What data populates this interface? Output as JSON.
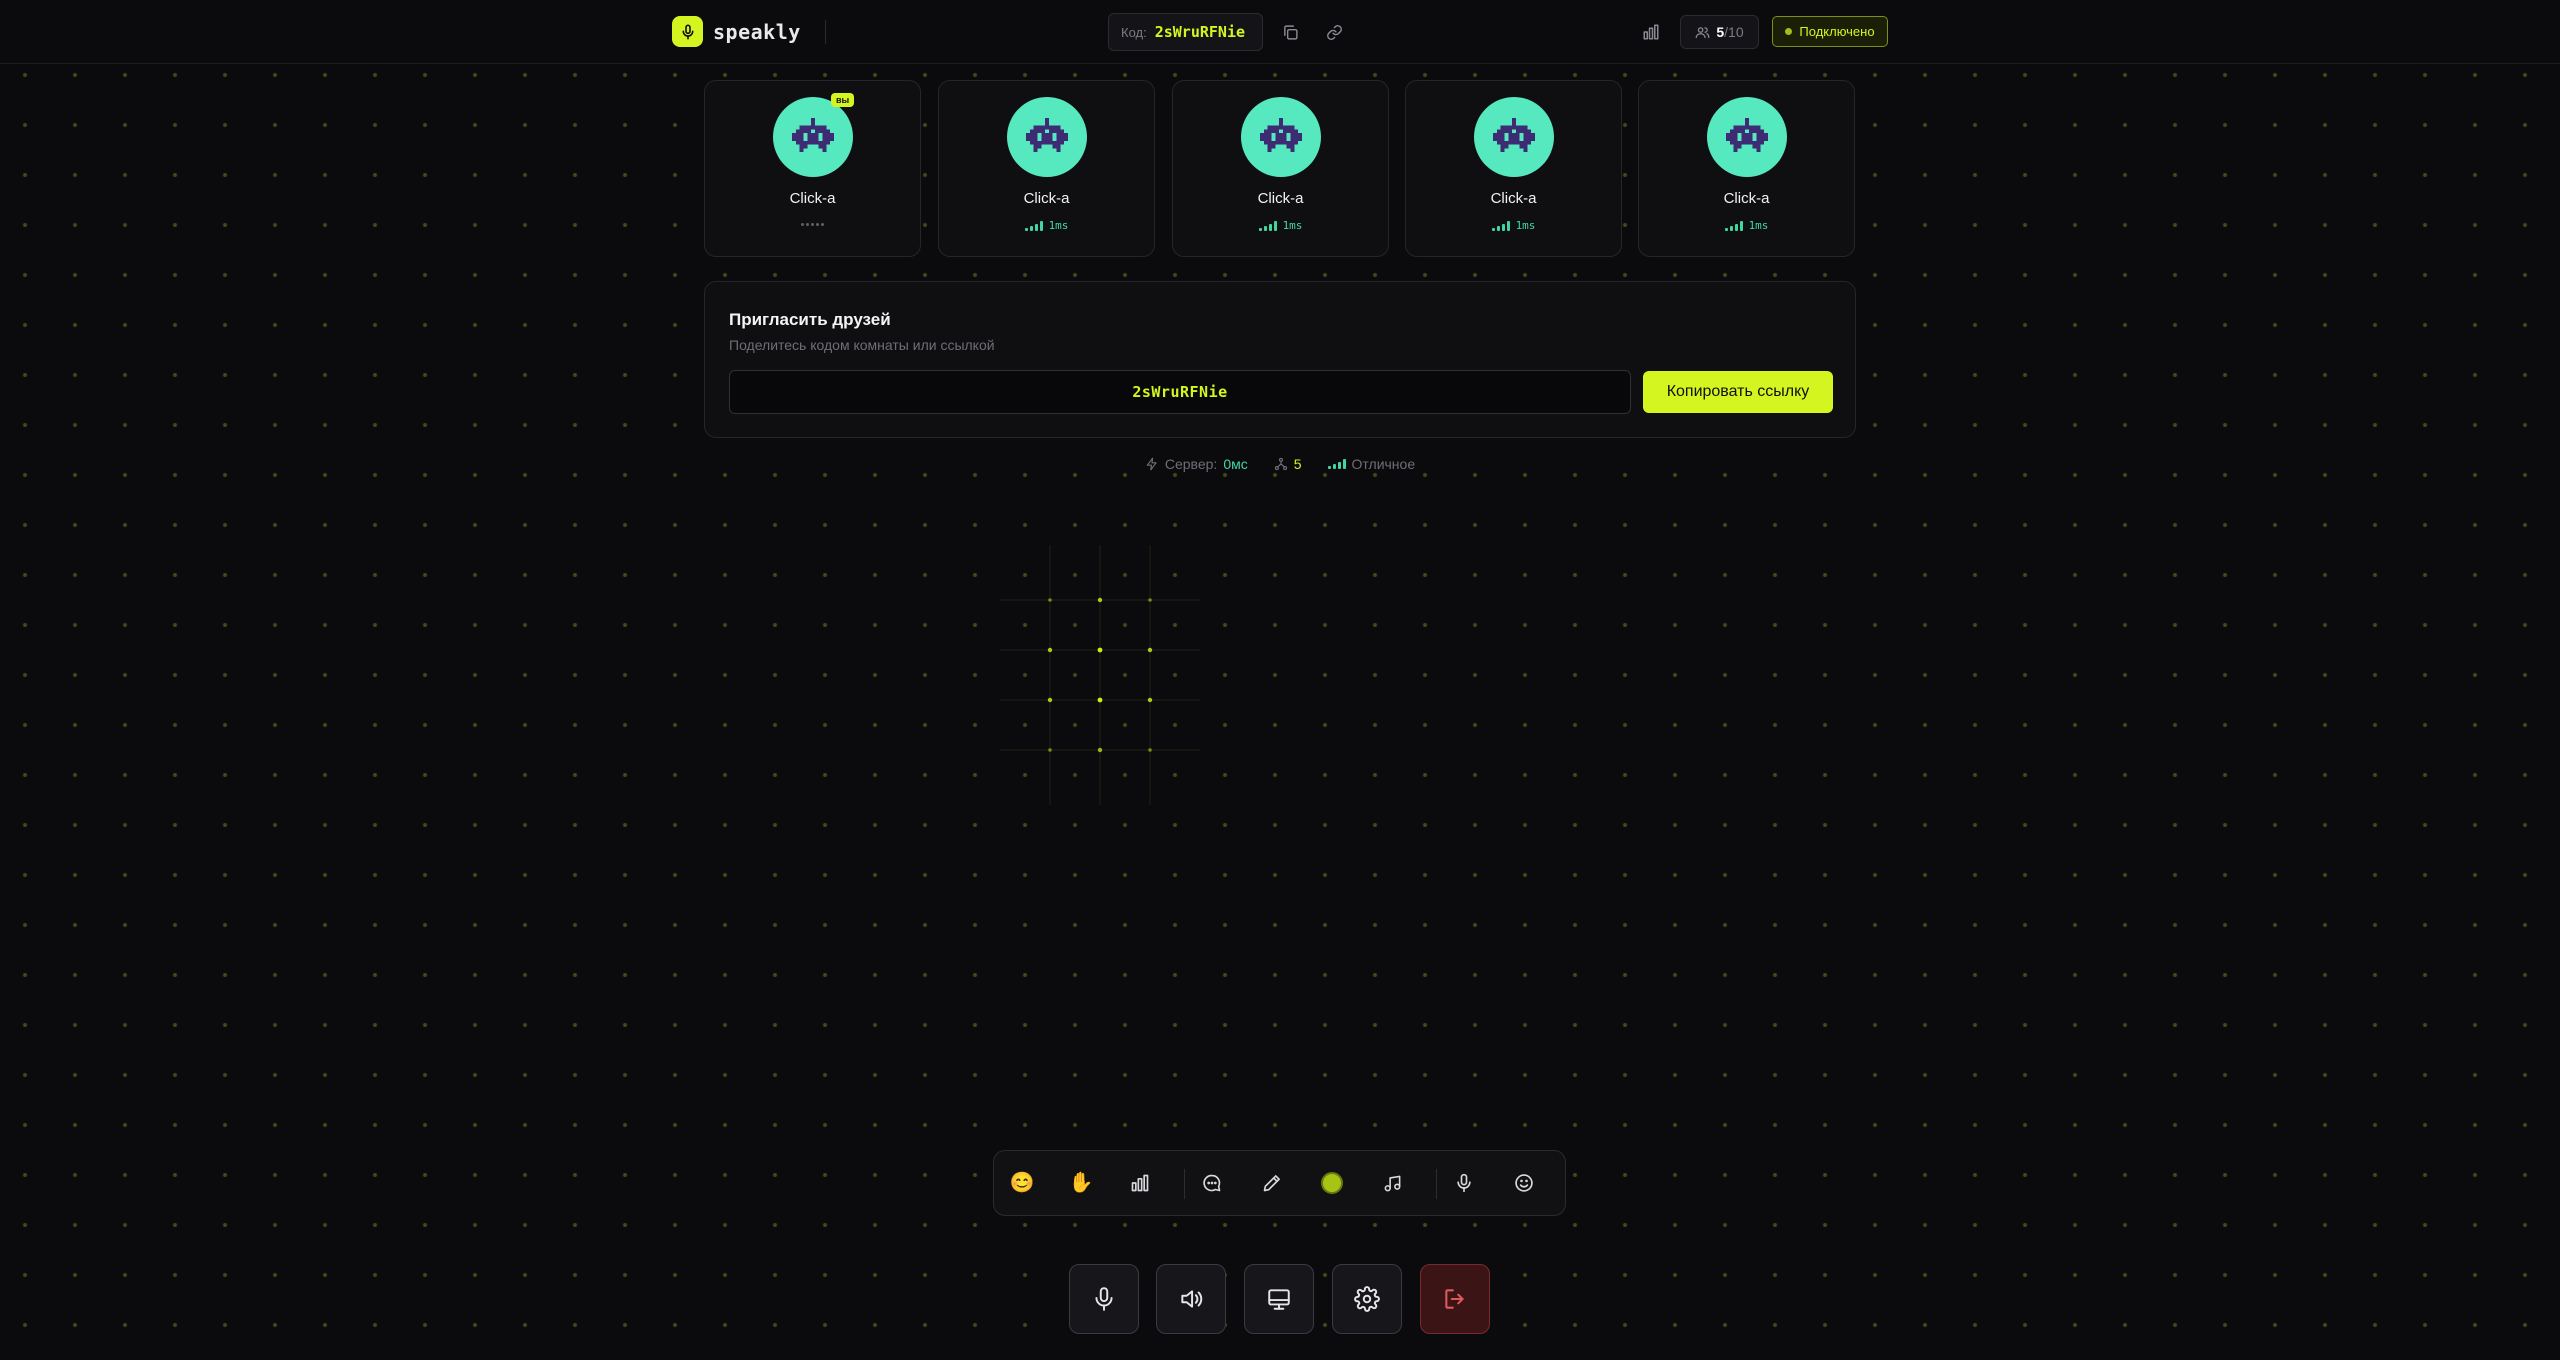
{
  "app": {
    "name": "speakly"
  },
  "header": {
    "code_label": "Код:",
    "room_code": "2sWruRFNie",
    "participants_current": "5",
    "participants_max": "/10",
    "status": "Подключено"
  },
  "participants": [
    {
      "name": "Click-a",
      "is_self": true,
      "badge": "вы",
      "ping": ""
    },
    {
      "name": "Click-a",
      "is_self": false,
      "ping": "1ms"
    },
    {
      "name": "Click-a",
      "is_self": false,
      "ping": "1ms"
    },
    {
      "name": "Click-a",
      "is_self": false,
      "ping": "1ms"
    },
    {
      "name": "Click-a",
      "is_self": false,
      "ping": "1ms"
    }
  ],
  "invite": {
    "title": "Пригласить друзей",
    "subtitle": "Поделитесь кодом комнаты или ссылкой",
    "code": "2sWruRFNie",
    "copy_label": "Копировать ссылку"
  },
  "stats": {
    "server_label": "Сервер:",
    "server_value": "0мс",
    "users_value": "5",
    "quality_value": "Отличное"
  },
  "toolbar": {
    "emoji_reaction": "😊",
    "hand_reaction": "✋",
    "selected_color": "#a7c414"
  },
  "colors": {
    "accent": "#d4f51f",
    "avatar": "#56e8be",
    "ping": "#42d6a4",
    "leave": "#e05a5a"
  }
}
